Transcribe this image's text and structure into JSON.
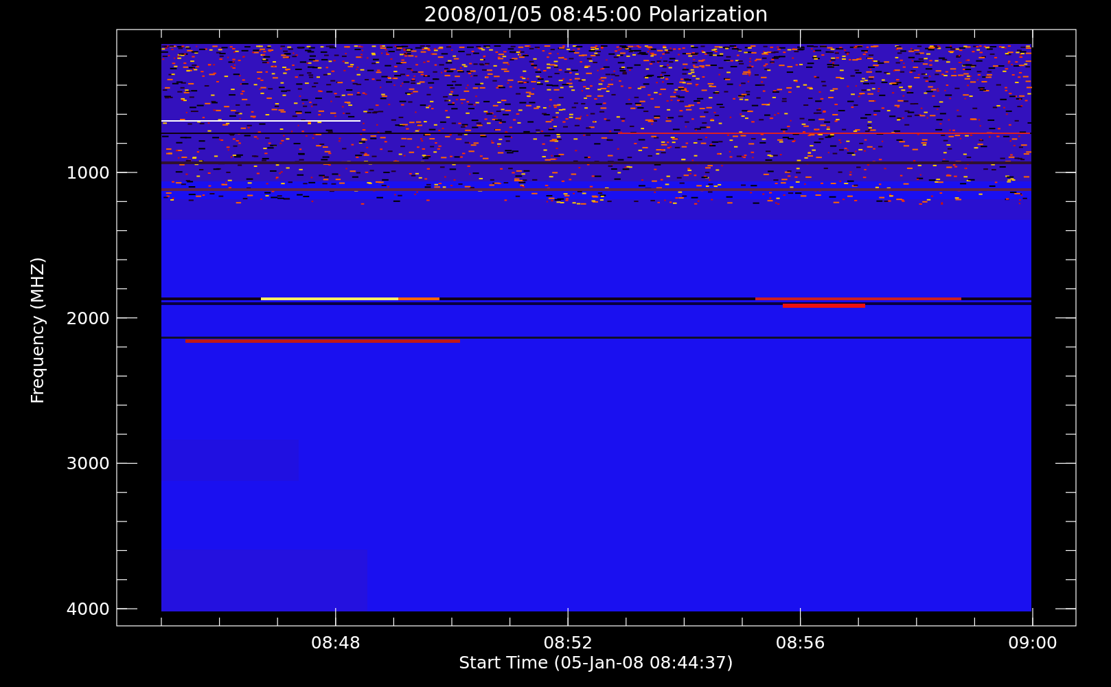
{
  "plot": {
    "title": "2008/01/05 08:45:00 Polarization",
    "ylabel": "Frequency (MHZ)",
    "xlabel": "Start Time (05-Jan-08 08:44:37)",
    "yticks": [
      "1000",
      "2000",
      "3000",
      "4000"
    ],
    "xticks": [
      "08:48",
      "08:52",
      "08:56",
      "09:00"
    ]
  }
}
